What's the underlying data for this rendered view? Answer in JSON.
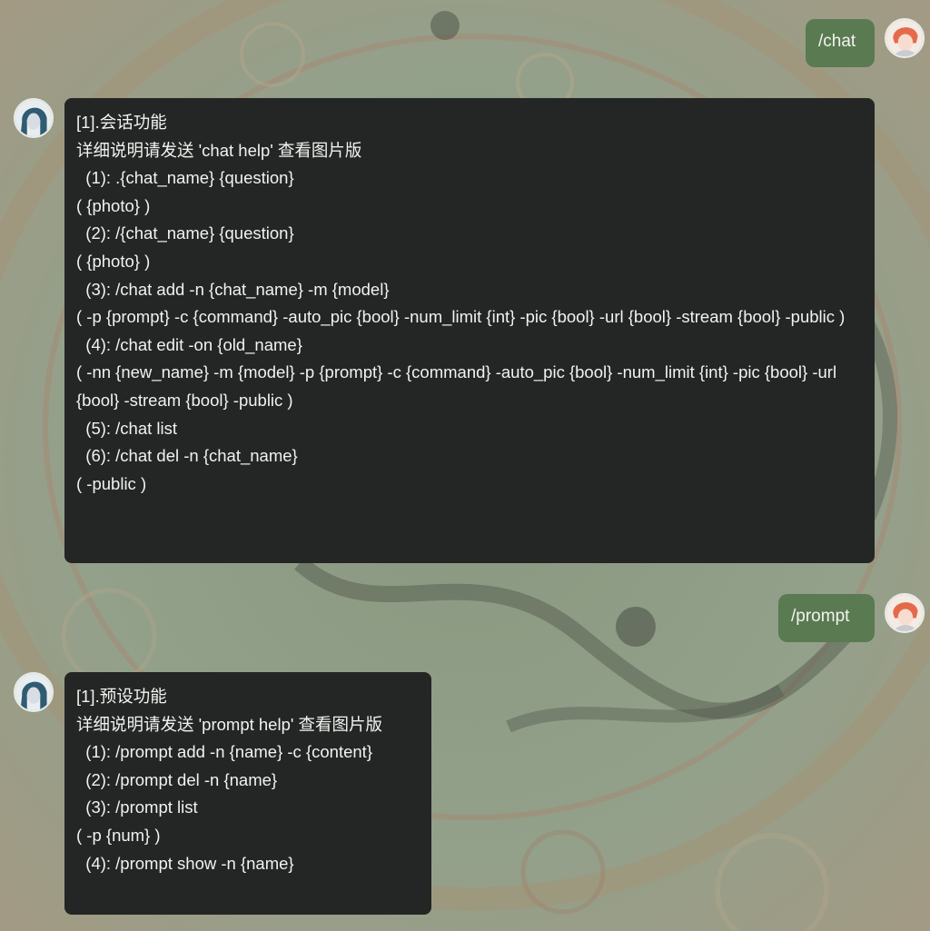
{
  "background_colors": {
    "base": "#8f9a86",
    "bot_bubble": "#232624",
    "user_bubble": "#5a7a52",
    "text": "#f2f2f0"
  },
  "messages": [
    {
      "role": "user",
      "avatar_icon": "user-avatar-icon",
      "text": "/chat"
    },
    {
      "role": "bot",
      "avatar_icon": "bot-avatar-icon",
      "lines": [
        "[1].会话功能",
        "详细说明请发送 'chat help' 查看图片版",
        "  (1): .{chat_name} {question}",
        "( {photo} )",
        "  (2): /{chat_name} {question}",
        "( {photo} )",
        "  (3): /chat add -n {chat_name} -m {model}",
        "( -p {prompt} -c {command} -auto_pic {bool} -num_limit {int} -pic {bool} -url {bool} -stream {bool} -public )",
        "  (4): /chat edit -on {old_name}",
        "( -nn {new_name} -m {model} -p {prompt} -c {command} -auto_pic {bool} -num_limit {int} -pic {bool} -url {bool} -stream {bool} -public )",
        "  (5): /chat list",
        "  (6): /chat del -n {chat_name}",
        "( -public )"
      ]
    },
    {
      "role": "user",
      "avatar_icon": "user-avatar-icon",
      "text": "/prompt"
    },
    {
      "role": "bot",
      "avatar_icon": "bot-avatar-icon",
      "lines": [
        "[1].预设功能",
        "详细说明请发送 'prompt help' 查看图片版",
        "  (1): /prompt add -n {name} -c {content}",
        "  (2): /prompt del -n {name}",
        "  (3): /prompt list",
        "( -p {num} )",
        "  (4): /prompt show -n {name}"
      ]
    }
  ]
}
